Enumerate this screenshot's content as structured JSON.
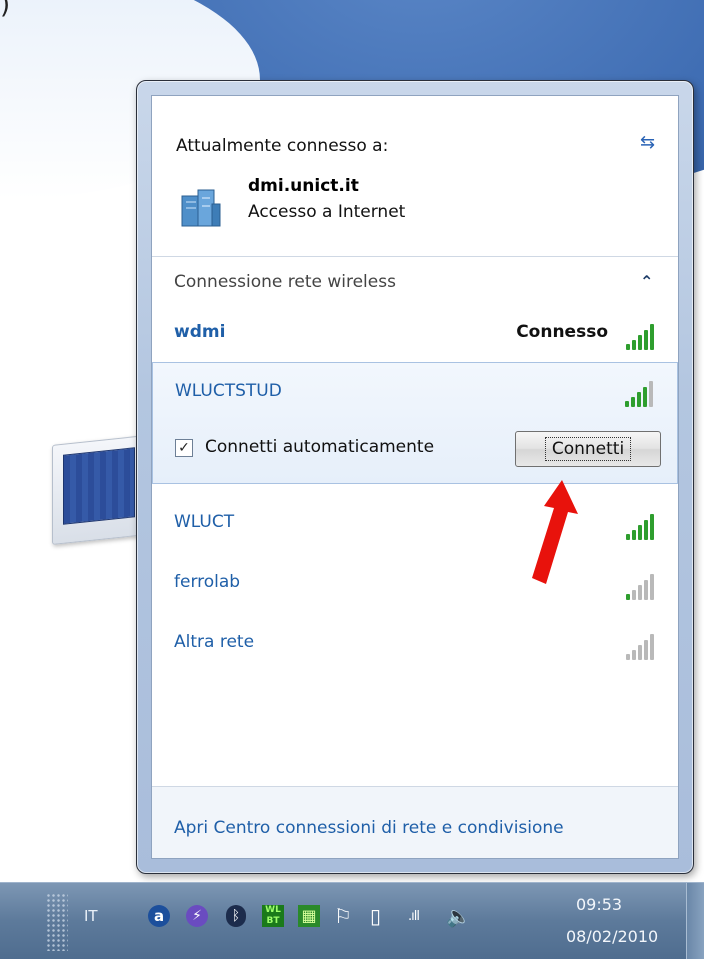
{
  "desktop": {
    "corner_text": ")"
  },
  "flyout": {
    "current_label": "Attualmente connesso a:",
    "current_network": {
      "name": "dmi.unict.it",
      "status": "Accesso a Internet"
    },
    "section_label": "Connessione rete wireless",
    "networks": [
      {
        "name": "wdmi",
        "state": "Connesso",
        "signal": 5
      },
      {
        "name": "WLUCTSTUD",
        "state": "",
        "signal": 4
      },
      {
        "name": "WLUCT",
        "state": "",
        "signal": 5
      },
      {
        "name": "ferrolab",
        "state": "",
        "signal": 1
      },
      {
        "name": "Altra rete",
        "state": "",
        "signal": 0
      }
    ],
    "auto_connect_label": "Connetti automaticamente",
    "auto_connect_checked": true,
    "connect_button": "Connetti",
    "footer_link": "Apri Centro connessioni di rete e condivisione"
  },
  "taskbar": {
    "language": "IT",
    "time": "09:53",
    "date": "08/02/2010"
  },
  "colors": {
    "link": "#1f5fa8",
    "arrow": "#e8120c",
    "signal_on": "#2e9e2e",
    "signal_off": "#b9b9b9"
  }
}
